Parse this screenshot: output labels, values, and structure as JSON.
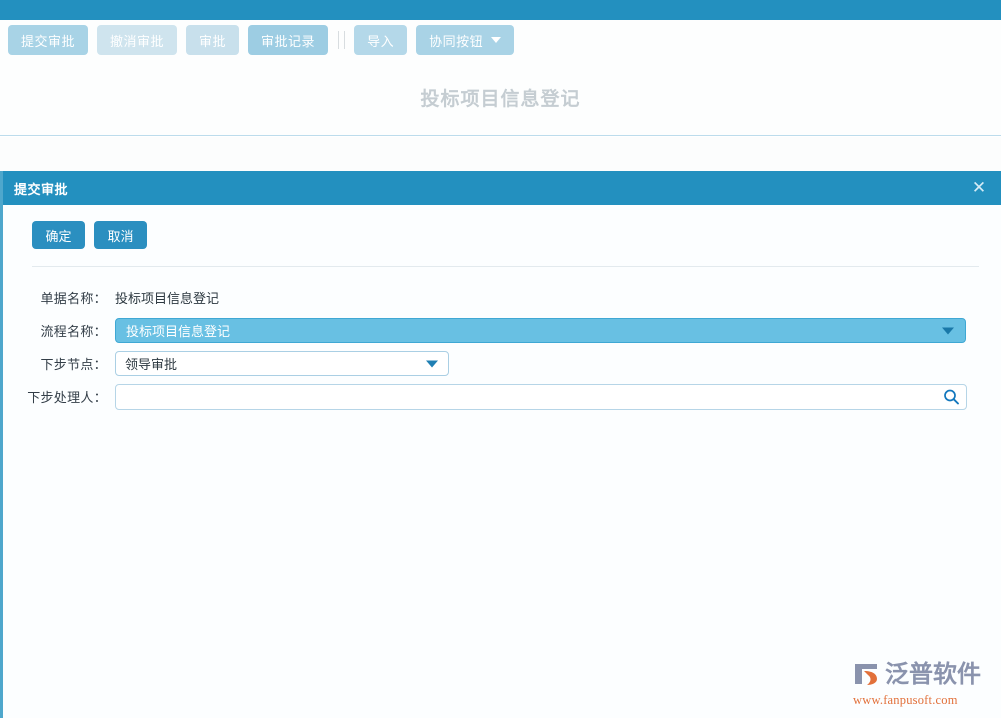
{
  "theme": {
    "accent": "#2390bf",
    "accent_light": "#68c0e3",
    "button_blue": "#2b8fc0",
    "title_gray": "#c5cdd2",
    "watermark_text": "#8a93ad",
    "watermark_url": "#e2703a"
  },
  "toolbar": {
    "buttons": [
      {
        "label": "提交审批",
        "shade": "shade-a",
        "has_caret": false
      },
      {
        "label": "撤消审批",
        "shade": "shade-b",
        "has_caret": false
      },
      {
        "label": "审批",
        "shade": "shade-c",
        "has_caret": false
      },
      {
        "label": "审批记录",
        "shade": "shade-d",
        "has_caret": false
      },
      {
        "label": "导入",
        "shade": "shade-e",
        "has_caret": false
      },
      {
        "label": "协同按钮",
        "shade": "shade-f",
        "has_caret": true
      }
    ]
  },
  "page": {
    "title": "投标项目信息登记"
  },
  "dialog": {
    "title": "提交审批",
    "close_icon": "✕",
    "actions": [
      {
        "label": "确定",
        "name": "confirm-button"
      },
      {
        "label": "取消",
        "name": "cancel-button"
      }
    ],
    "fields": [
      {
        "label": "单据名称：",
        "type": "static",
        "value": "投标项目信息登记"
      },
      {
        "label": "流程名称：",
        "type": "select-highlight",
        "value": "投标项目信息登记",
        "options": [
          "投标项目信息登记"
        ]
      },
      {
        "label": "下步节点：",
        "type": "select",
        "value": "领导审批",
        "options": [
          "领导审批"
        ]
      },
      {
        "label": "下步处理人：",
        "type": "search",
        "value": "",
        "placeholder": ""
      }
    ]
  },
  "watermark": {
    "brand": "泛普软件",
    "url": "www.fanpusoft.com"
  }
}
